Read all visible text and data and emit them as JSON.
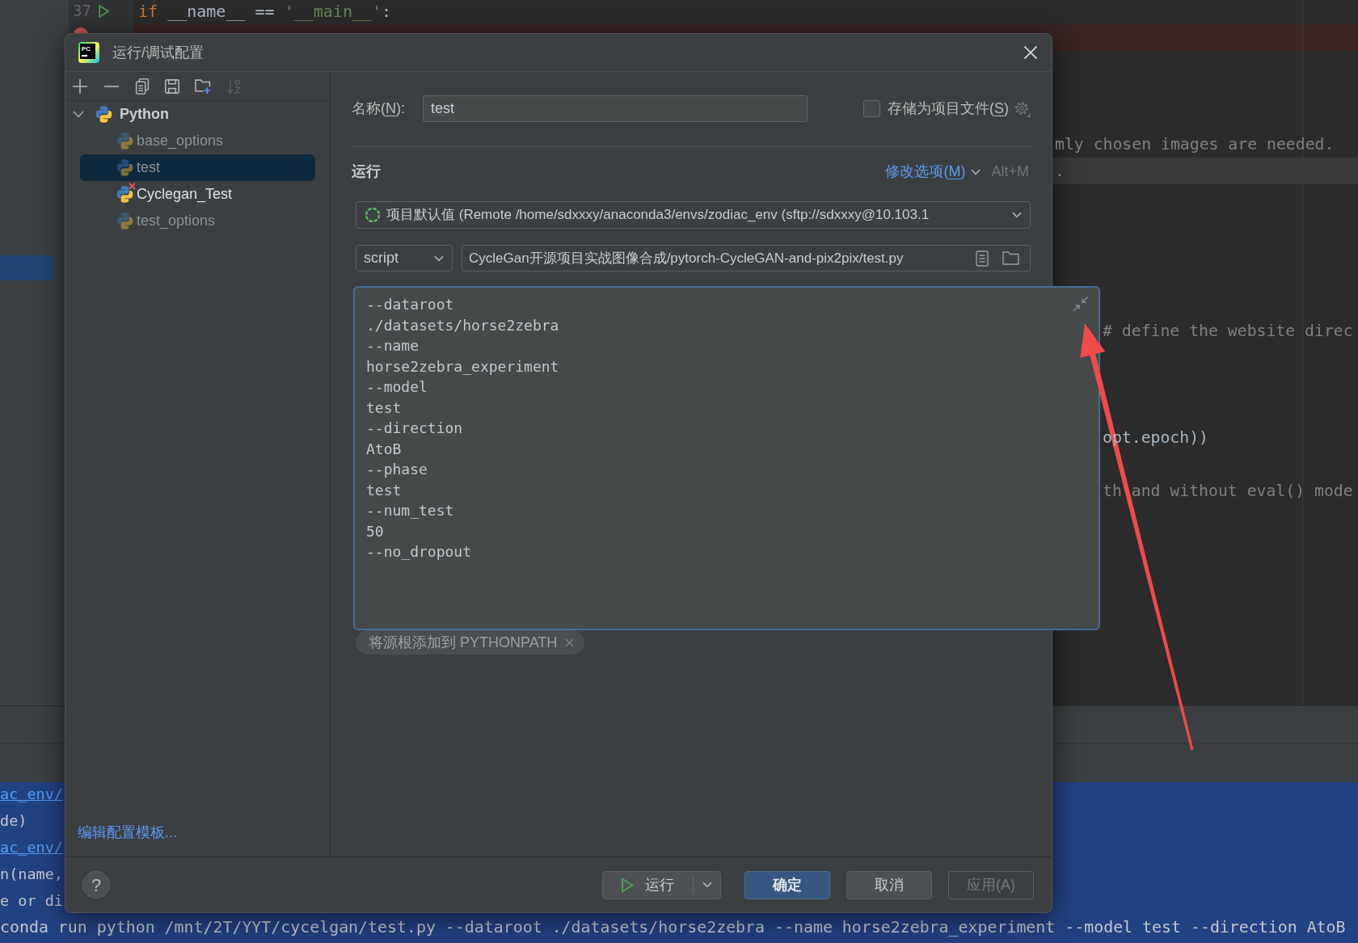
{
  "editor": {
    "line_number": "37",
    "code": [
      {
        "text": "if",
        "kind": "keyword"
      },
      {
        "text": " __name__ == ",
        "kind": "plain"
      },
      {
        "text": "'__main__'",
        "kind": "string"
      },
      {
        "text": ":",
        "kind": "plain"
      }
    ],
    "breakpoint": true,
    "fragments": [
      {
        "text": "mly chosen images are needed.",
        "kind": "comment",
        "current_line": false
      },
      {
        "text": ".",
        "kind": "comment",
        "current_line": true
      },
      {
        "text": "# define the website direc",
        "kind": "comment",
        "current_line": false
      },
      {
        "text": "opt.epoch))",
        "kind": "plain",
        "current_line": false
      },
      {
        "text": "th and without eval() mode",
        "kind": "comment",
        "current_line": false
      }
    ]
  },
  "console": {
    "lines": [
      {
        "text": "ac_env/",
        "kind": "link"
      },
      {
        "text": "de)",
        "kind": "plain"
      },
      {
        "text": "ac_env/",
        "kind": "link"
      },
      {
        "text": "n(name,",
        "kind": "plain"
      },
      {
        "text": "e or di",
        "kind": "plain"
      },
      {
        "text": "conda run python /mnt/2T/YYT/cycelgan/test.py --dataroot ./datasets/horse2zebra --name horse2zebra_experiment --model test --direction AtoB",
        "kind": "command"
      }
    ]
  },
  "dialog": {
    "title": "运行/调试配置",
    "logo_text": "PC",
    "toolbar": [
      {
        "kind": "add",
        "disabled": false
      },
      {
        "kind": "remove",
        "disabled": false
      },
      {
        "kind": "copy",
        "disabled": false
      },
      {
        "kind": "save",
        "disabled": false
      },
      {
        "kind": "new-folder",
        "disabled": false
      },
      {
        "kind": "sort",
        "disabled": true
      }
    ],
    "tree": [
      {
        "label": "Python",
        "expanded": true,
        "selected": false,
        "children": [
          {
            "label": "base_options",
            "selected": false,
            "temporary": true,
            "error": false
          },
          {
            "label": "test",
            "selected": true,
            "temporary": true,
            "error": false
          },
          {
            "label": "Cyclegan_Test",
            "selected": false,
            "temporary": false,
            "error": true
          },
          {
            "label": "test_options",
            "selected": false,
            "temporary": true,
            "error": false
          }
        ]
      }
    ],
    "edit_templates_link": "编辑配置模板...",
    "name": {
      "label": {
        "text": "名称(",
        "mnemonic": "N",
        "rest": "):"
      },
      "value": "test"
    },
    "store_as_project_file": {
      "label": {
        "text": "存储为项目文件(",
        "mnemonic": "S",
        "rest": ")"
      },
      "checked": false
    },
    "section_title": "运行",
    "modify_options": {
      "label": {
        "text": "修改选项(",
        "mnemonic": "M",
        "rest": ")"
      },
      "shortcut": "Alt+M"
    },
    "interpreter": {
      "value": "项目默认值 (Remote /home/sdxxxy/anaconda3/envs/zodiac_env (sftp://sdxxxy@10.103.1"
    },
    "target": {
      "mode": "script",
      "path": "CycleGan开源项目实战图像合成/pytorch-CycleGAN-and-pix2pix/test.py"
    },
    "parameters": {
      "lines": [
        "--dataroot",
        "./datasets/horse2zebra",
        "--name",
        "horse2zebra_experiment",
        "--model",
        "test",
        "--direction",
        "AtoB",
        "--phase",
        "test",
        "--num_test",
        "50",
        "--no_dropout"
      ]
    },
    "chips": [
      {
        "label": "将源根添加到 PYTHONPATH"
      }
    ],
    "help": "?",
    "buttons": [
      {
        "label": "运行",
        "kind": "run",
        "default": false,
        "disabled": false
      },
      {
        "label": "确定",
        "kind": "plain",
        "default": true,
        "disabled": false
      },
      {
        "label": "取消",
        "kind": "plain",
        "default": false,
        "disabled": false
      },
      {
        "label": "应用(A)",
        "kind": "plain",
        "default": false,
        "disabled": true
      }
    ]
  }
}
